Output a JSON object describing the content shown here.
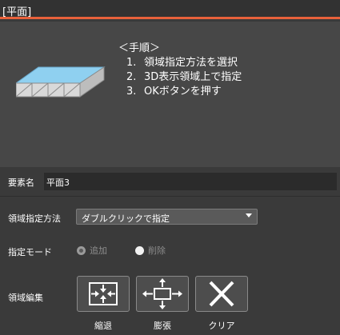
{
  "window": {
    "title": "[平面]",
    "accent_color": "#e8613b"
  },
  "procedure": {
    "header": "＜手順＞",
    "steps": [
      {
        "num": "1.",
        "text": "領域指定方法を選択"
      },
      {
        "num": "2.",
        "text": "3D表示領域上で指定"
      },
      {
        "num": "3.",
        "text": "OKボタンを押す"
      }
    ]
  },
  "element": {
    "label": "要素名",
    "value": "平面3"
  },
  "area_method": {
    "label": "領域指定方法",
    "selected": "ダブルクリックで指定"
  },
  "mode": {
    "label": "指定モード",
    "options": [
      {
        "label": "追加",
        "checked": true
      },
      {
        "label": "削除",
        "checked": false
      }
    ]
  },
  "area_edit": {
    "label": "領域編集",
    "buttons": [
      {
        "label": "縮退",
        "icon": "shrink-icon"
      },
      {
        "label": "膨張",
        "icon": "expand-icon"
      },
      {
        "label": "クリア",
        "icon": "clear-x-icon"
      }
    ]
  }
}
